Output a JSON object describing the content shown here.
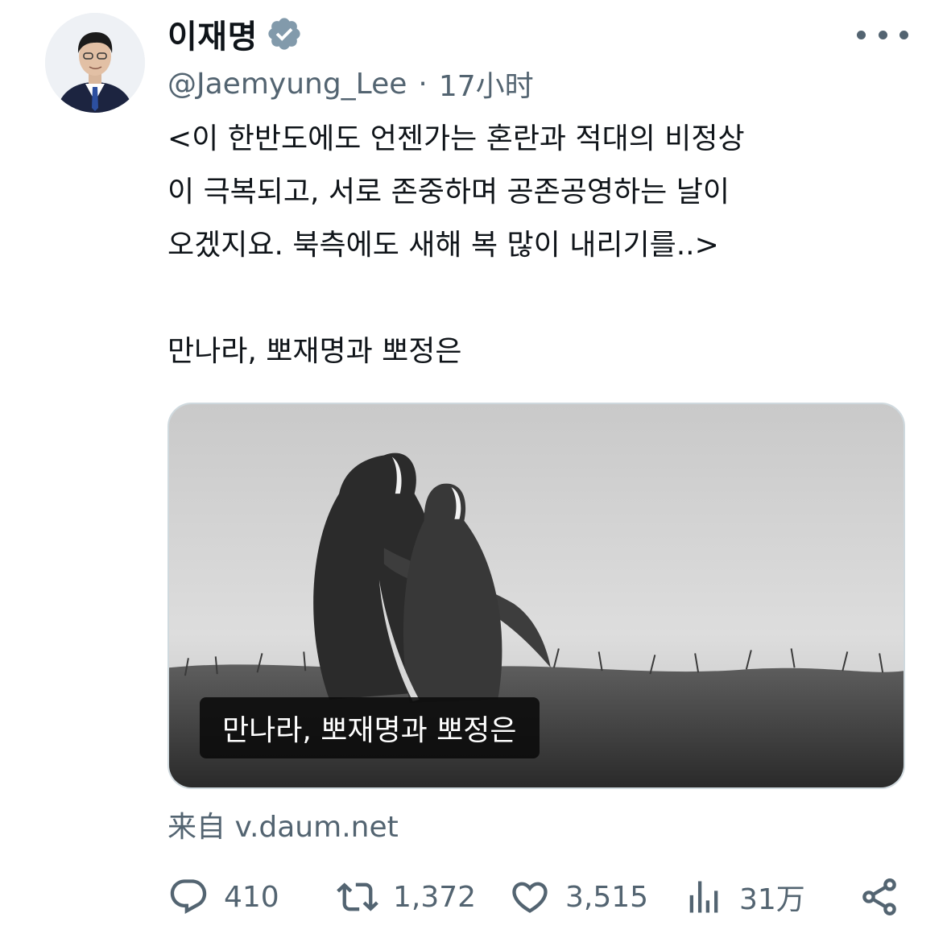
{
  "author": {
    "name": "이재명",
    "handle": "@Jaemyung_Lee",
    "separator": "·",
    "time": "17小时",
    "verified_icon": "verified-badge-icon",
    "avatar_icon": "profile-photo"
  },
  "more_icon": "more-options-icon",
  "tweet": {
    "lines": [
      "<이 한반도에도 언젠가는 혼란과 적대의 비정상",
      "이 극복되고, 서로 존중하며 공존공영하는 날이",
      "오겠지요. 북측에도 새해 복 많이 내리기를..>"
    ],
    "closing": "만나라, 뽀재명과 뽀정은"
  },
  "media": {
    "caption": "만나라, 뽀재명과 뽀정은"
  },
  "source": "来自 v.daum.net",
  "actions": {
    "reply": {
      "icon": "reply-icon",
      "count": "410"
    },
    "retweet": {
      "icon": "retweet-icon",
      "count": "1,372"
    },
    "like": {
      "icon": "heart-icon",
      "count": "3,515"
    },
    "views": {
      "icon": "views-chart-icon",
      "count": "31万"
    },
    "share": {
      "icon": "share-icon"
    }
  },
  "colors": {
    "text": "#0f1419",
    "secondary": "#536471",
    "border": "#cfd9de",
    "verified_gray": "#829aab"
  }
}
